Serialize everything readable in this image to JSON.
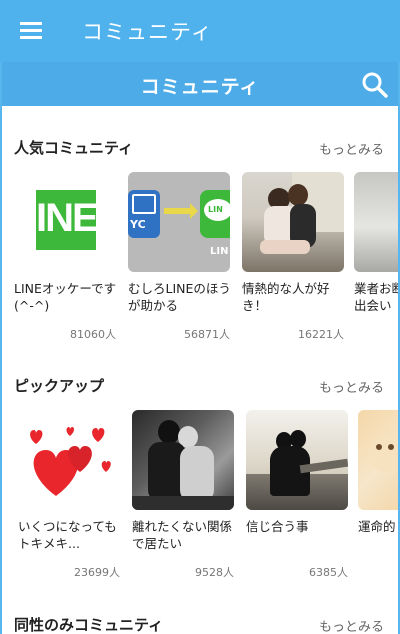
{
  "appbar": {
    "title": "コミュニティ"
  },
  "header": {
    "title": "コミュニティ"
  },
  "sections": [
    {
      "title": "人気コミュニティ",
      "more": "もっとみる",
      "cards": [
        {
          "name": "LINEオッケーです(^-^)",
          "count": "81060人"
        },
        {
          "name": "むしろLINEのほうが助かる",
          "count": "56871人"
        },
        {
          "name": "情熱的な人が好き！",
          "count": "16221人"
        },
        {
          "name": "業者お断り 普通の出会い",
          "count": ""
        }
      ]
    },
    {
      "title": "ピックアップ",
      "more": "もっとみる",
      "cards": [
        {
          "name": "いくつになってもトキメキ...",
          "count": "23699人"
        },
        {
          "name": "離れたくない関係で居たい",
          "count": "9528人"
        },
        {
          "name": "信じ合う事",
          "count": "6385人"
        },
        {
          "name": "運命的 い...",
          "count": ""
        }
      ]
    },
    {
      "title": "同性のみコミュニティ",
      "more": "もっとみる"
    }
  ],
  "thumb_text": {
    "yc": "YC",
    "line": "LINE",
    "line_short": "LIN",
    "line_big": "INE"
  },
  "colors": {
    "appbar": "#4fb2ec",
    "subheader": "#4dabe8",
    "line_green": "#3db83a"
  }
}
